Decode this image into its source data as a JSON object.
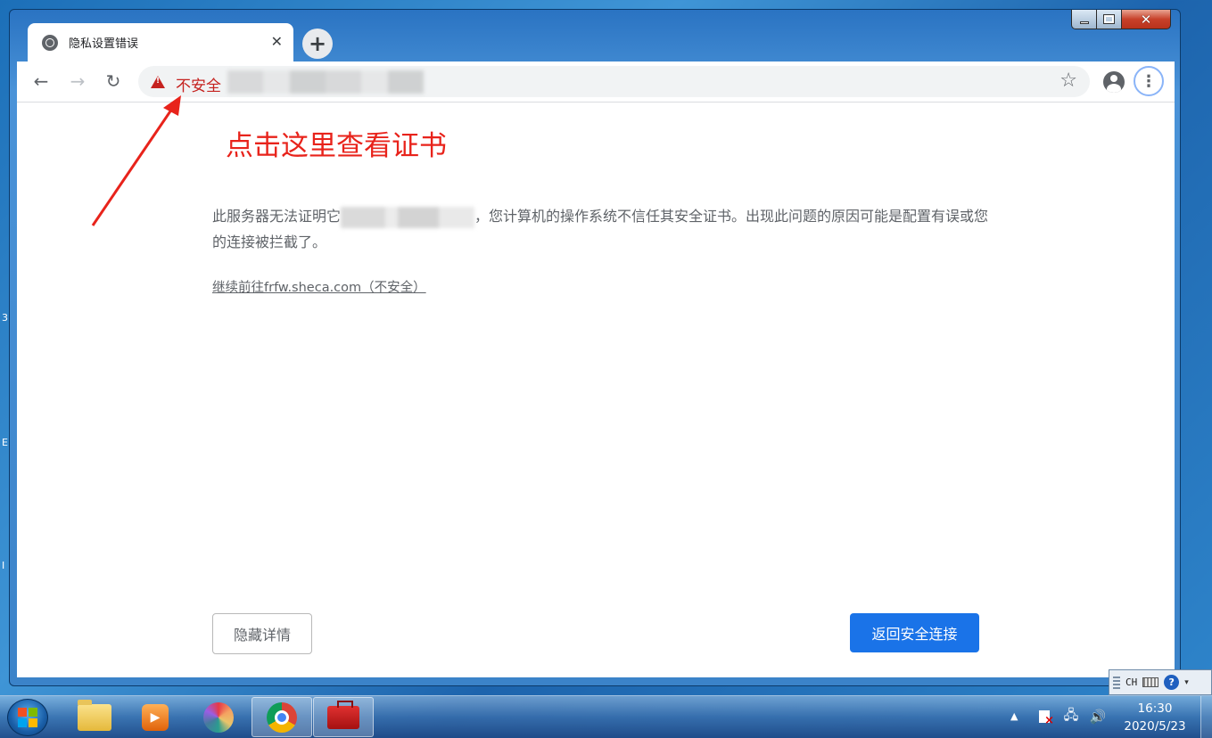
{
  "desktop": {
    "edge_chars": [
      "3",
      "E",
      "I"
    ]
  },
  "window": {
    "caption": {
      "minimize": "",
      "maximize": "",
      "close": ""
    }
  },
  "browser": {
    "tab": {
      "title": "隐私设置错误",
      "close_glyph": "✕"
    },
    "new_tab_glyph": "+",
    "toolbar": {
      "back_glyph": "←",
      "forward_glyph": "→",
      "reload_glyph": "↻",
      "security_label": "不安全",
      "star_glyph": "☆",
      "menu_glyph": "⋮"
    }
  },
  "page": {
    "annotation": "点击这里查看证书",
    "message_before": "此服务器无法证明它",
    "message_after": "，您计算机的操作系统不信任其安全证书。出现此问题的原因可能是配置有误或您的连接被拦截了。",
    "proceed_link": "继续前往frfw.sheca.com（不安全）",
    "hide_details_button": "隐藏详情",
    "back_to_safety_button": "返回安全连接"
  },
  "annotation_arrow_color": "#e8231b",
  "langbar": {
    "lang": "CH",
    "help": "?"
  },
  "taskbar": {
    "apps": [
      "folder-icon",
      "media-player-icon",
      "pinwheel-icon",
      "chrome-icon",
      "toolbox-icon"
    ],
    "tray_arrow": "▲",
    "clock": {
      "time": "16:30",
      "date": "2020/5/23"
    }
  }
}
